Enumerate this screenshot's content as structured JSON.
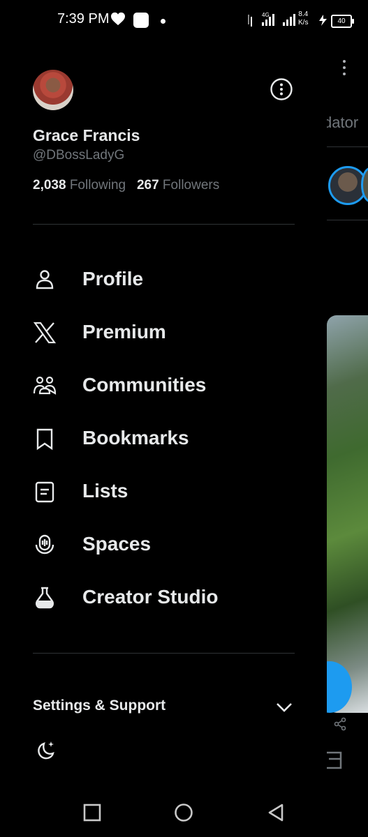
{
  "status_bar": {
    "time": "7:39 PM",
    "network_speed_value": "8.4",
    "network_speed_unit": "K/s",
    "network_type": "4G",
    "battery": "40"
  },
  "drawer": {
    "user": {
      "name": "Grace Francis",
      "handle": "@DBossLadyG",
      "following_count": "2,038",
      "following_label": "Following",
      "followers_count": "267",
      "followers_label": "Followers"
    },
    "menu": [
      {
        "label": "Profile",
        "icon": "person-icon"
      },
      {
        "label": "Premium",
        "icon": "x-logo-icon"
      },
      {
        "label": "Communities",
        "icon": "communities-icon"
      },
      {
        "label": "Bookmarks",
        "icon": "bookmark-icon"
      },
      {
        "label": "Lists",
        "icon": "list-icon"
      },
      {
        "label": "Spaces",
        "icon": "microphone-icon"
      },
      {
        "label": "Creator Studio",
        "icon": "flask-icon"
      }
    ],
    "settings_label": "Settings & Support"
  },
  "background": {
    "tab_partial": "dator"
  },
  "colors": {
    "background": "#000000",
    "text_primary": "#e7e9ea",
    "text_secondary": "#71767b",
    "divider": "#2f3336",
    "accent": "#1d9bf0"
  }
}
